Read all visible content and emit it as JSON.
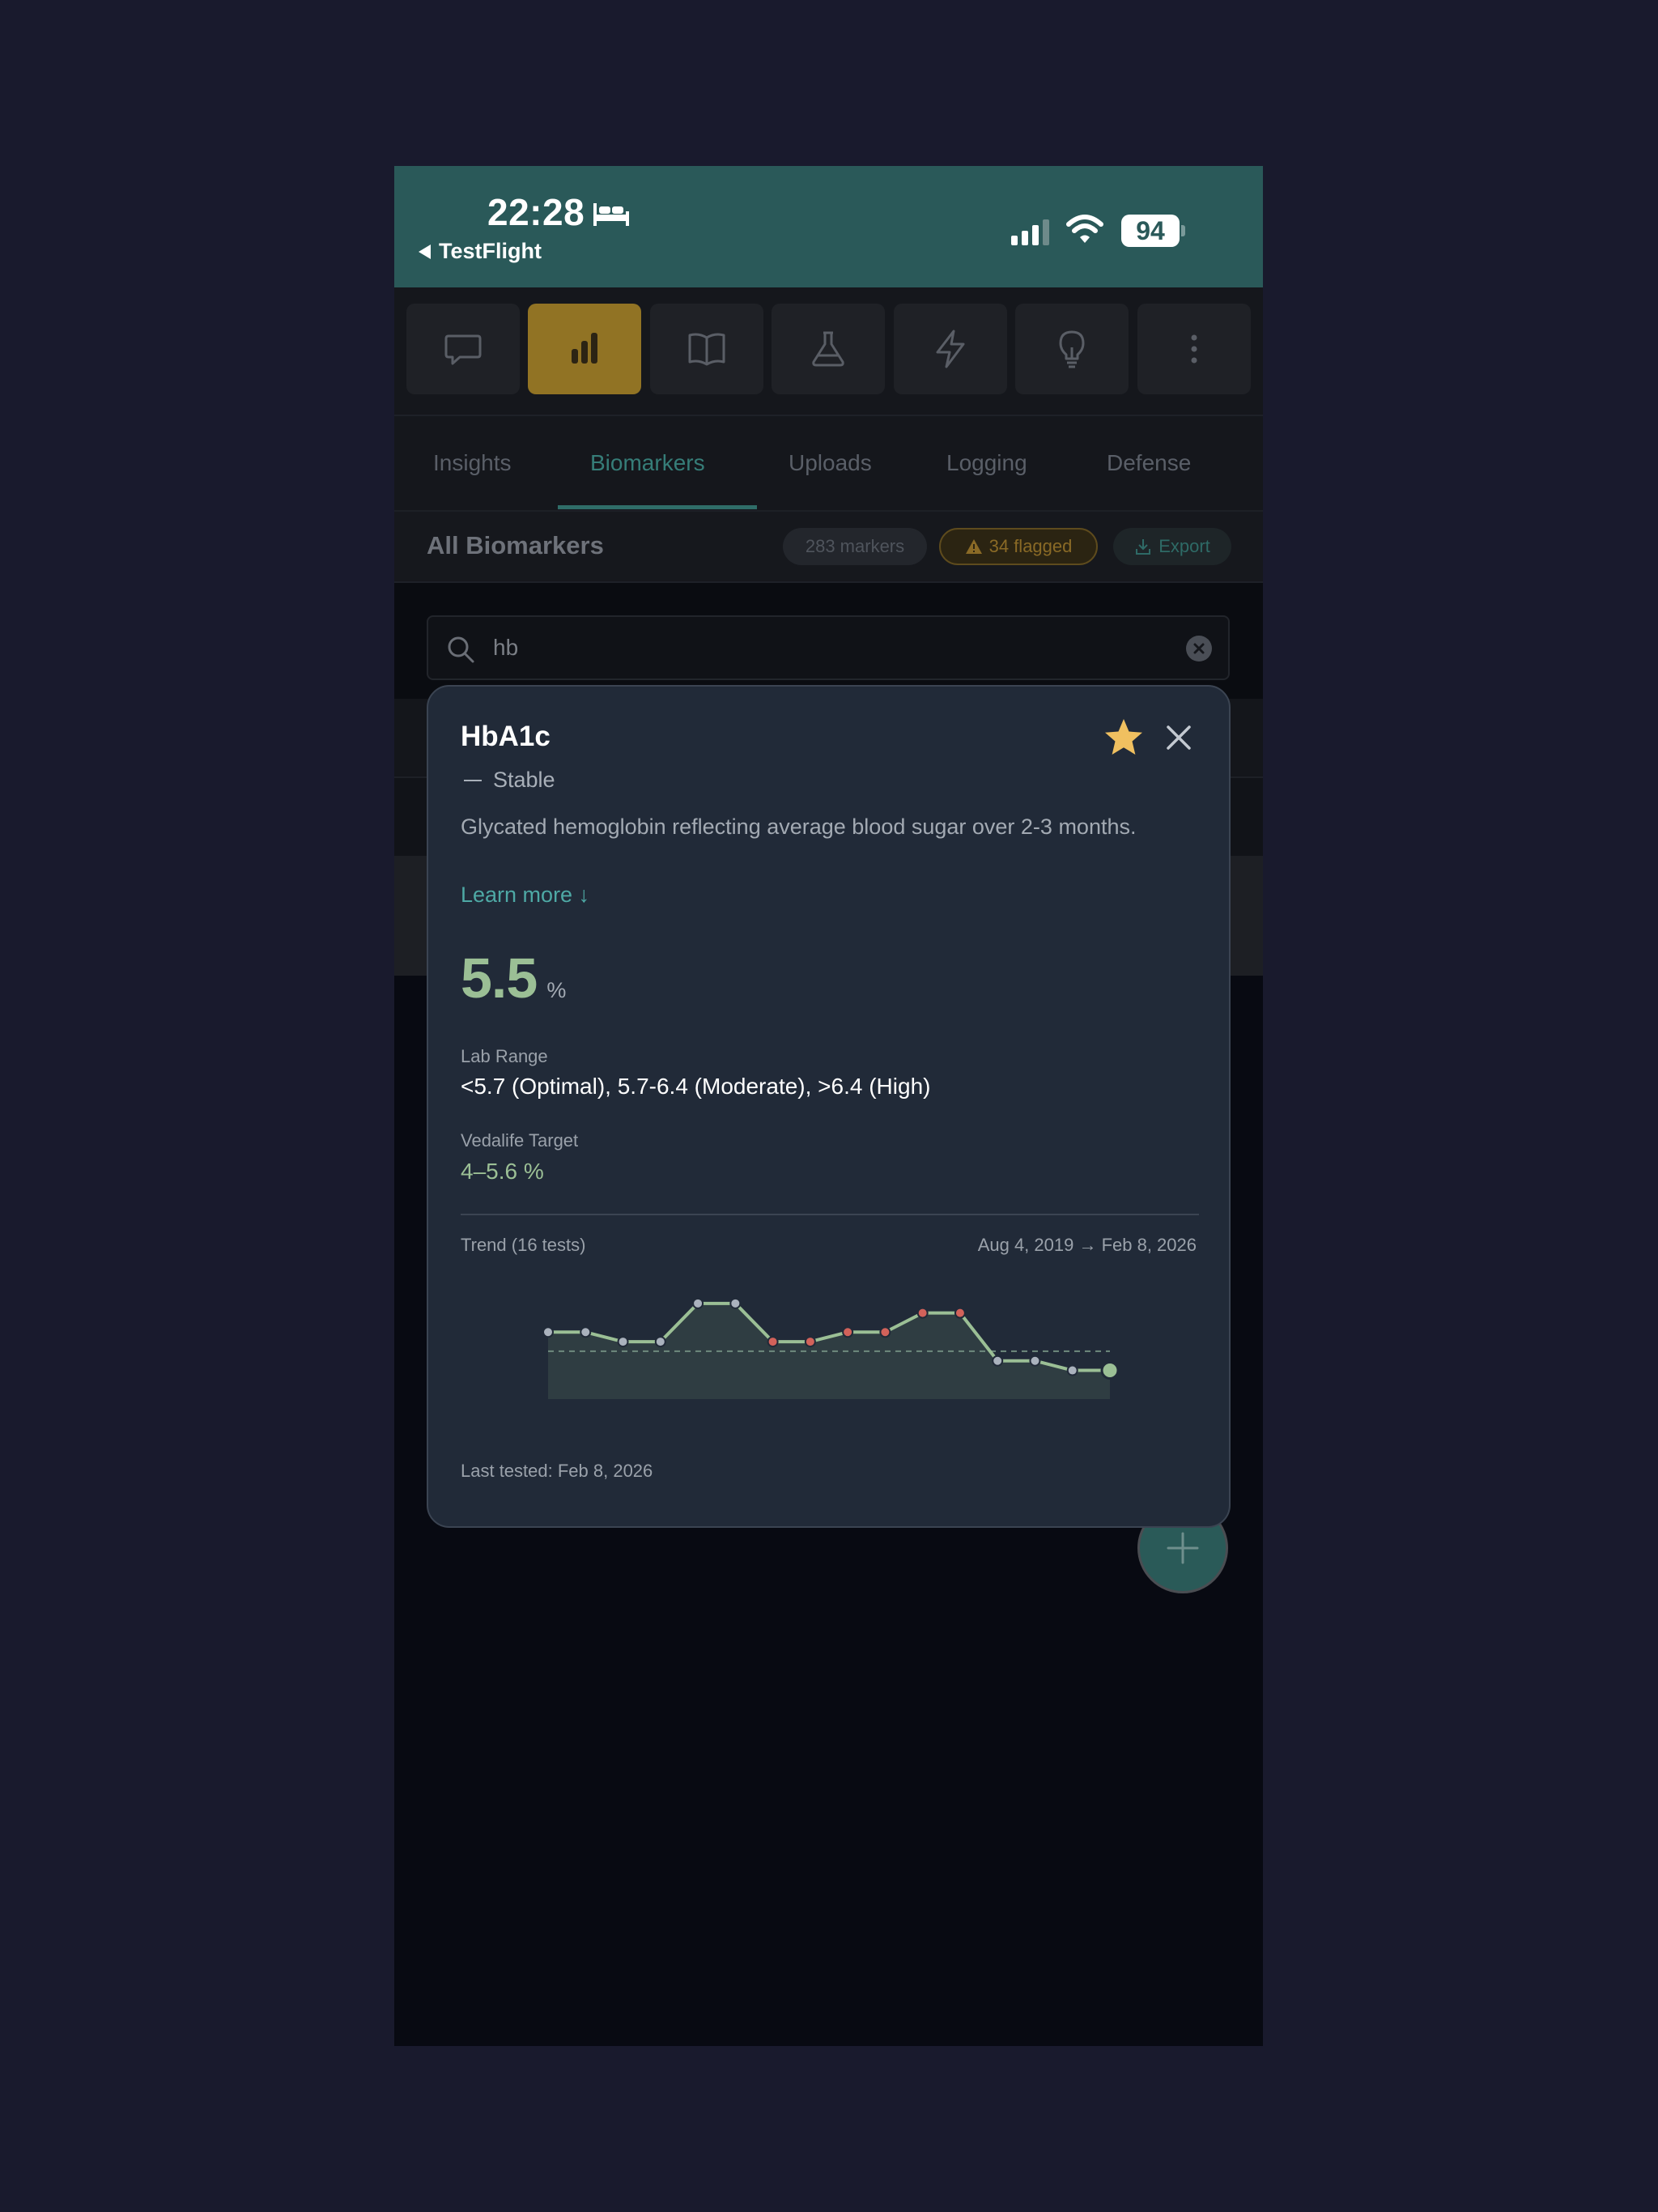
{
  "status": {
    "time": "22:28",
    "back_label": "TestFlight",
    "battery": "94"
  },
  "toolbar": {
    "icons": [
      "chat-icon",
      "bar-chart-icon",
      "book-icon",
      "flask-icon",
      "lightning-icon",
      "lightbulb-icon",
      "more-vertical-icon"
    ],
    "active_index": 1,
    "active_color": "#917324"
  },
  "tabs": [
    {
      "label": "Insights"
    },
    {
      "label": "Biomarkers",
      "active": true
    },
    {
      "label": "Uploads"
    },
    {
      "label": "Logging"
    },
    {
      "label": "Defense"
    }
  ],
  "header": {
    "title": "All Biomarkers",
    "markers_chip": "283 markers",
    "flagged_chip": "34 flagged",
    "export_label": "Export"
  },
  "search": {
    "value": "hb",
    "placeholder": ""
  },
  "modal": {
    "title": "HbA1c",
    "favorited": true,
    "trend_status": "Stable",
    "description": "Glycated hemoglobin reflecting average blood sugar over 2-3 months.",
    "learn_more": "Learn more ↓",
    "value": "5.5",
    "unit": "%",
    "lab_range_label": "Lab Range",
    "lab_range_value": "<5.7 (Optimal), 5.7-6.4 (Moderate), >6.4 (High)",
    "target_label": "Vedalife Target",
    "target_value": "4–5.6 %",
    "trend_label": "Trend (16 tests)",
    "trend_range": "Aug 4, 2019 → Feb 8, 2026",
    "last_tested": "Last tested: Feb 8, 2026"
  },
  "colors": {
    "accent": "#2a5959",
    "value_green": "#9bbf95",
    "link": "#4ea9a5",
    "flag": "#d2625a",
    "star": "#f0c060"
  },
  "chart_data": {
    "type": "line",
    "values": [
      5.6,
      5.6,
      5.55,
      5.55,
      5.75,
      5.75,
      5.55,
      5.55,
      5.6,
      5.6,
      5.7,
      5.7,
      5.45,
      5.45,
      5.4,
      5.4
    ],
    "flagged": [
      false,
      false,
      false,
      false,
      false,
      false,
      true,
      true,
      true,
      true,
      true,
      true,
      false,
      false,
      false,
      false
    ],
    "reference_line": 5.5,
    "ylim": [
      5.25,
      5.8
    ],
    "grid": false,
    "title": "",
    "xlabel": "",
    "ylabel": ""
  }
}
